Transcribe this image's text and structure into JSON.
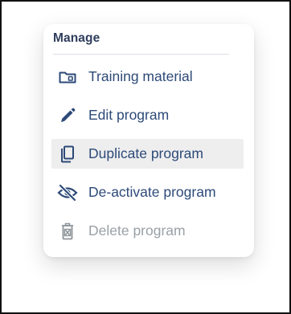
{
  "menu": {
    "header": "Manage",
    "items": [
      {
        "label": "Training material",
        "icon": "folder-icon",
        "state": "normal"
      },
      {
        "label": "Edit program",
        "icon": "pencil-icon",
        "state": "normal"
      },
      {
        "label": "Duplicate program",
        "icon": "copy-icon",
        "state": "hover"
      },
      {
        "label": "De-activate program",
        "icon": "eye-off-icon",
        "state": "normal"
      },
      {
        "label": "Delete program",
        "icon": "trash-icon",
        "state": "disabled"
      }
    ]
  },
  "colors": {
    "text": "#2d4a78",
    "header": "#2f3d5c",
    "icon": "#2d4a78",
    "disabled": "#9aa0a6",
    "hover_bg": "#eeeeee"
  }
}
